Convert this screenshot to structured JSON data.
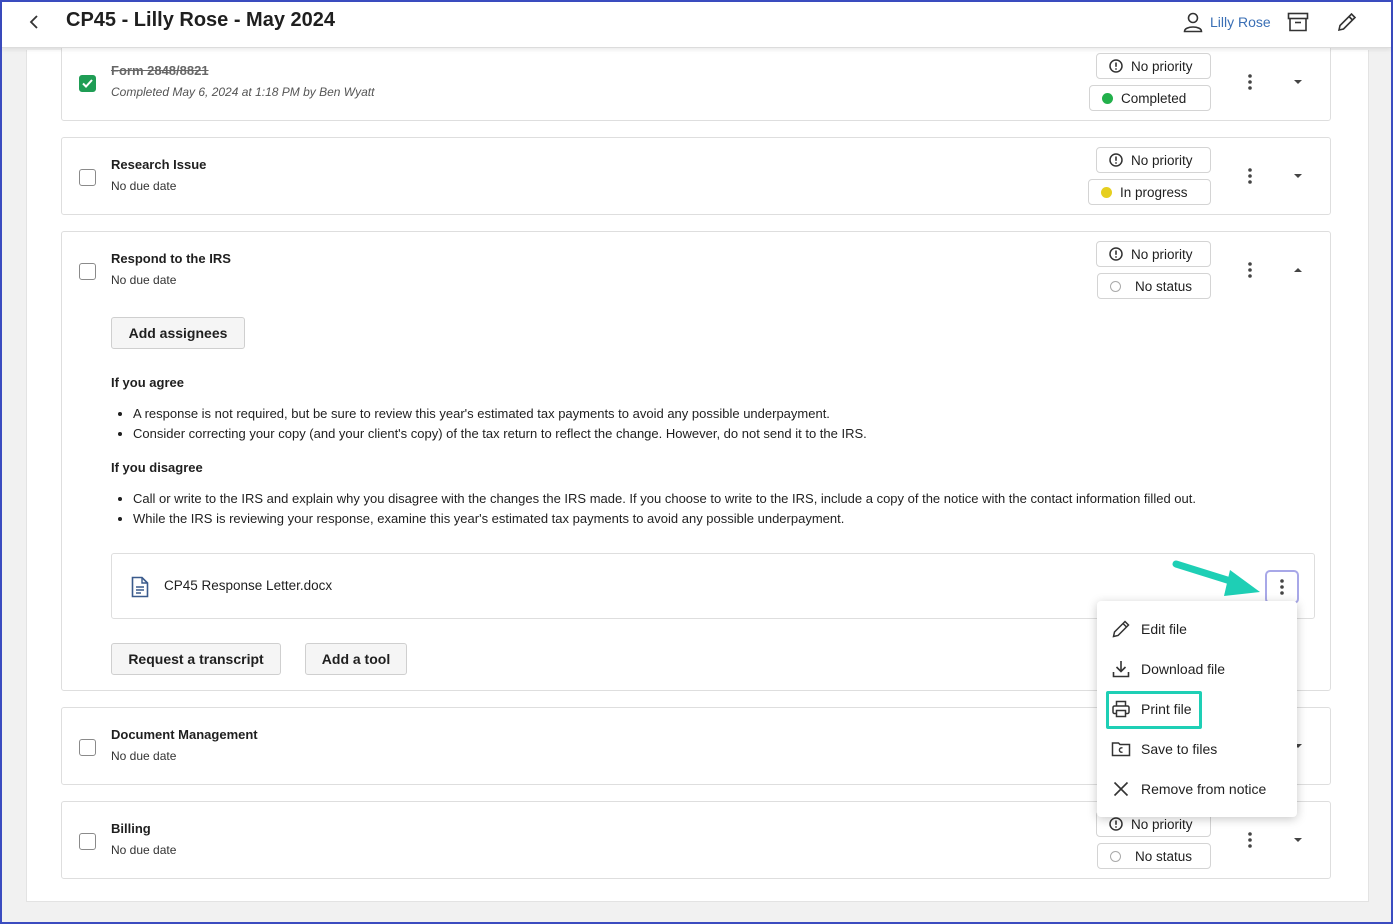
{
  "header": {
    "title": "CP45 - Lilly Rose - May 2024",
    "user_name": "Lilly Rose"
  },
  "tasks": [
    {
      "title": "Form 2848/8821",
      "subtitle": "Completed May 6, 2024 at 1:18 PM by Ben Wyatt",
      "checked": true,
      "priority": "No priority",
      "status": "Completed",
      "status_color": "#22b04b"
    },
    {
      "title": "Research Issue",
      "subtitle": "No due date",
      "checked": false,
      "priority": "No priority",
      "status": "In progress",
      "status_color": "#e6cf1f"
    },
    {
      "title": "Respond to the IRS",
      "subtitle": "No due date",
      "checked": false,
      "priority": "No priority",
      "status": "No status",
      "expanded": true,
      "add_assignees_label": "Add assignees",
      "agree_heading": "If you agree",
      "agree_bullets": [
        "A response is not required, but be sure to review this year's estimated tax payments to avoid any possible underpayment.",
        "Consider correcting your copy (and your client's copy) of the tax return to reflect the change. However, do not send it to the IRS."
      ],
      "disagree_heading": "If you disagree",
      "disagree_bullets": [
        "Call or write to the IRS and explain why you disagree with the changes the IRS made. If you choose to write to the IRS, include a copy of the notice with the contact information filled out.",
        "While the IRS is reviewing your response, examine this year's estimated tax payments to avoid any possible underpayment."
      ],
      "file_name": "CP45 Response Letter.docx",
      "request_transcript_label": "Request a transcript",
      "add_tool_label": "Add a tool"
    },
    {
      "title": "Document Management",
      "subtitle": "No due date",
      "checked": false
    },
    {
      "title": "Billing",
      "subtitle": "No due date",
      "checked": false,
      "priority": "No priority",
      "status": "No status"
    }
  ],
  "file_menu": {
    "items": [
      {
        "label": "Edit file",
        "icon": "pencil-icon"
      },
      {
        "label": "Download file",
        "icon": "download-icon"
      },
      {
        "label": "Print file",
        "icon": "printer-icon",
        "highlighted": true
      },
      {
        "label": "Save to files",
        "icon": "folder-icon"
      },
      {
        "label": "Remove from notice",
        "icon": "close-icon"
      }
    ]
  },
  "colors": {
    "accent_link": "#3a6fb5",
    "completed_green": "#22b04b",
    "in_progress_yellow": "#e6cf1f",
    "annotation_teal": "#1ecfb5",
    "checkbox_green": "#1f9d55"
  }
}
